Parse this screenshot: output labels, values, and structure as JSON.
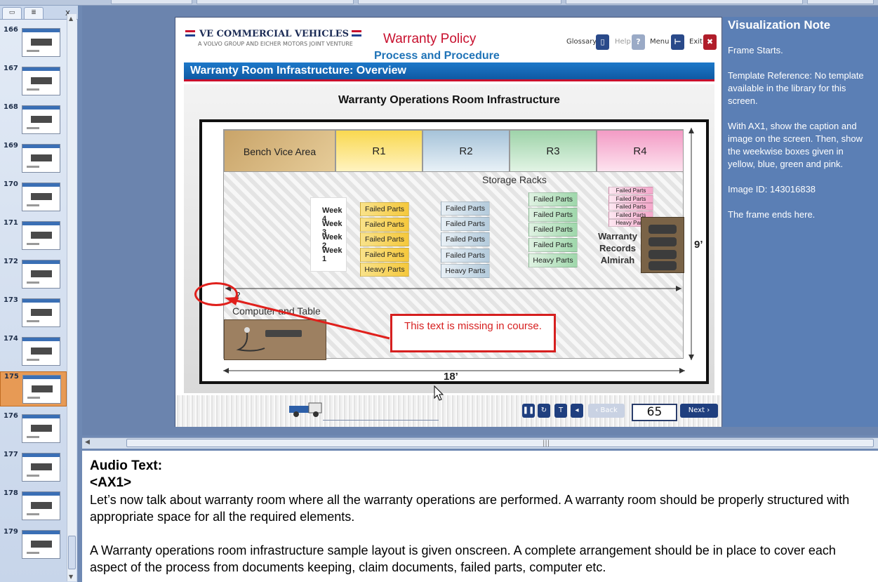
{
  "slides": [
    {
      "num": "166"
    },
    {
      "num": "167"
    },
    {
      "num": "168"
    },
    {
      "num": "169"
    },
    {
      "num": "170"
    },
    {
      "num": "171"
    },
    {
      "num": "172"
    },
    {
      "num": "173"
    },
    {
      "num": "174"
    },
    {
      "num": "175",
      "selected": true
    },
    {
      "num": "176"
    },
    {
      "num": "177"
    },
    {
      "num": "178"
    },
    {
      "num": "179"
    }
  ],
  "panel": {
    "close": "x"
  },
  "header": {
    "logo": "VE COMMERCIAL VEHICLES",
    "logo_sub": "A VOLVO GROUP AND EICHER MOTORS JOINT VENTURE",
    "title": "Warranty Policy",
    "subtitle": "Process and Procedure",
    "nav": {
      "glossary": "Glossary",
      "help": "Help",
      "menu": "Menu",
      "exit": "Exit"
    }
  },
  "screen_title": "Warranty Room Infrastructure: Overview",
  "diagram": {
    "title": "Warranty Operations Room Infrastructure",
    "bench": "Bench Vice Area",
    "racks": [
      "R1",
      "R2",
      "R3",
      "R4"
    ],
    "storage": "Storage Racks",
    "weeks": [
      "Week 4",
      "Week 3",
      "Week 2",
      "Week 1"
    ],
    "failed": "Failed Parts",
    "heavy": "Heavy Parts",
    "almirah": "Warranty Records Almirah",
    "computer": "Computer and Table",
    "dim_h": "9’",
    "dim_w": "18’",
    "question": "?"
  },
  "callout": "This text is missing in course.",
  "player": {
    "back": "Back",
    "page": "65",
    "next": "Next"
  },
  "notes_panel": {
    "title": "Visualization Note",
    "paras": [
      "Frame Starts.",
      "Template Reference: No template available in the library for this screen.",
      "With AX1, show the caption and image on the screen. Then, show the weekwise boxes given in yellow, blue, green and pink.",
      "Image ID: 143016838",
      "The frame ends here."
    ]
  },
  "audio": {
    "heading": "Audio Text:",
    "tag": "<AX1>",
    "p1": "Let’s now talk about warranty room where all the warranty operations are performed. A warranty room should be properly structured with appropriate space for all the required elements.",
    "p2": "A Warranty operations room infrastructure sample layout is given onscreen. A complete arrangement should be in place to cover each aspect of the process from documents keeping, claim documents, failed parts, computer etc."
  }
}
